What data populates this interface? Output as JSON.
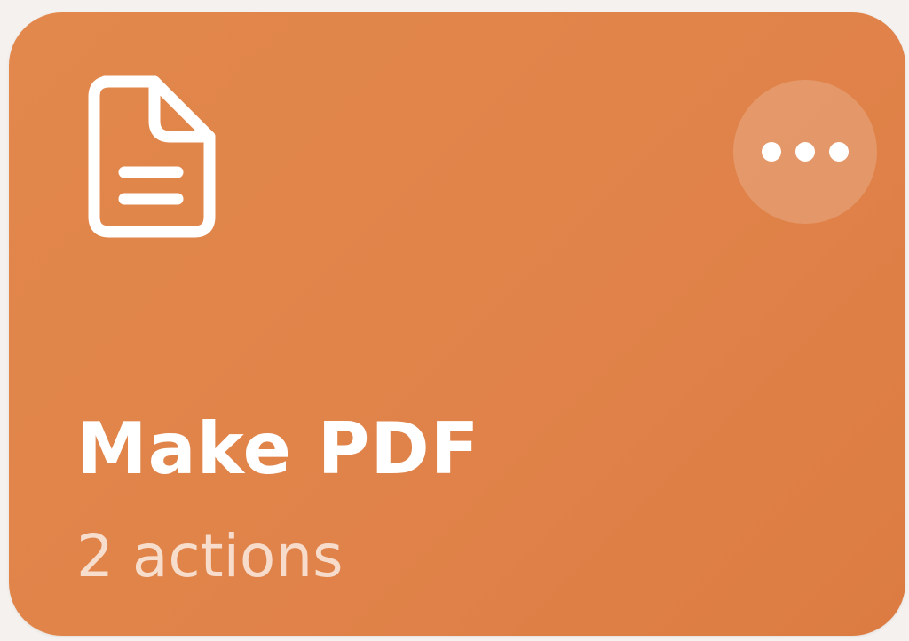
{
  "shortcut_card": {
    "title": "Make PDF",
    "subtitle": "2 actions",
    "icon": "document-icon",
    "more_icon": "ellipsis-icon",
    "background_color": "#e0834a",
    "text_color": "#ffffff"
  }
}
